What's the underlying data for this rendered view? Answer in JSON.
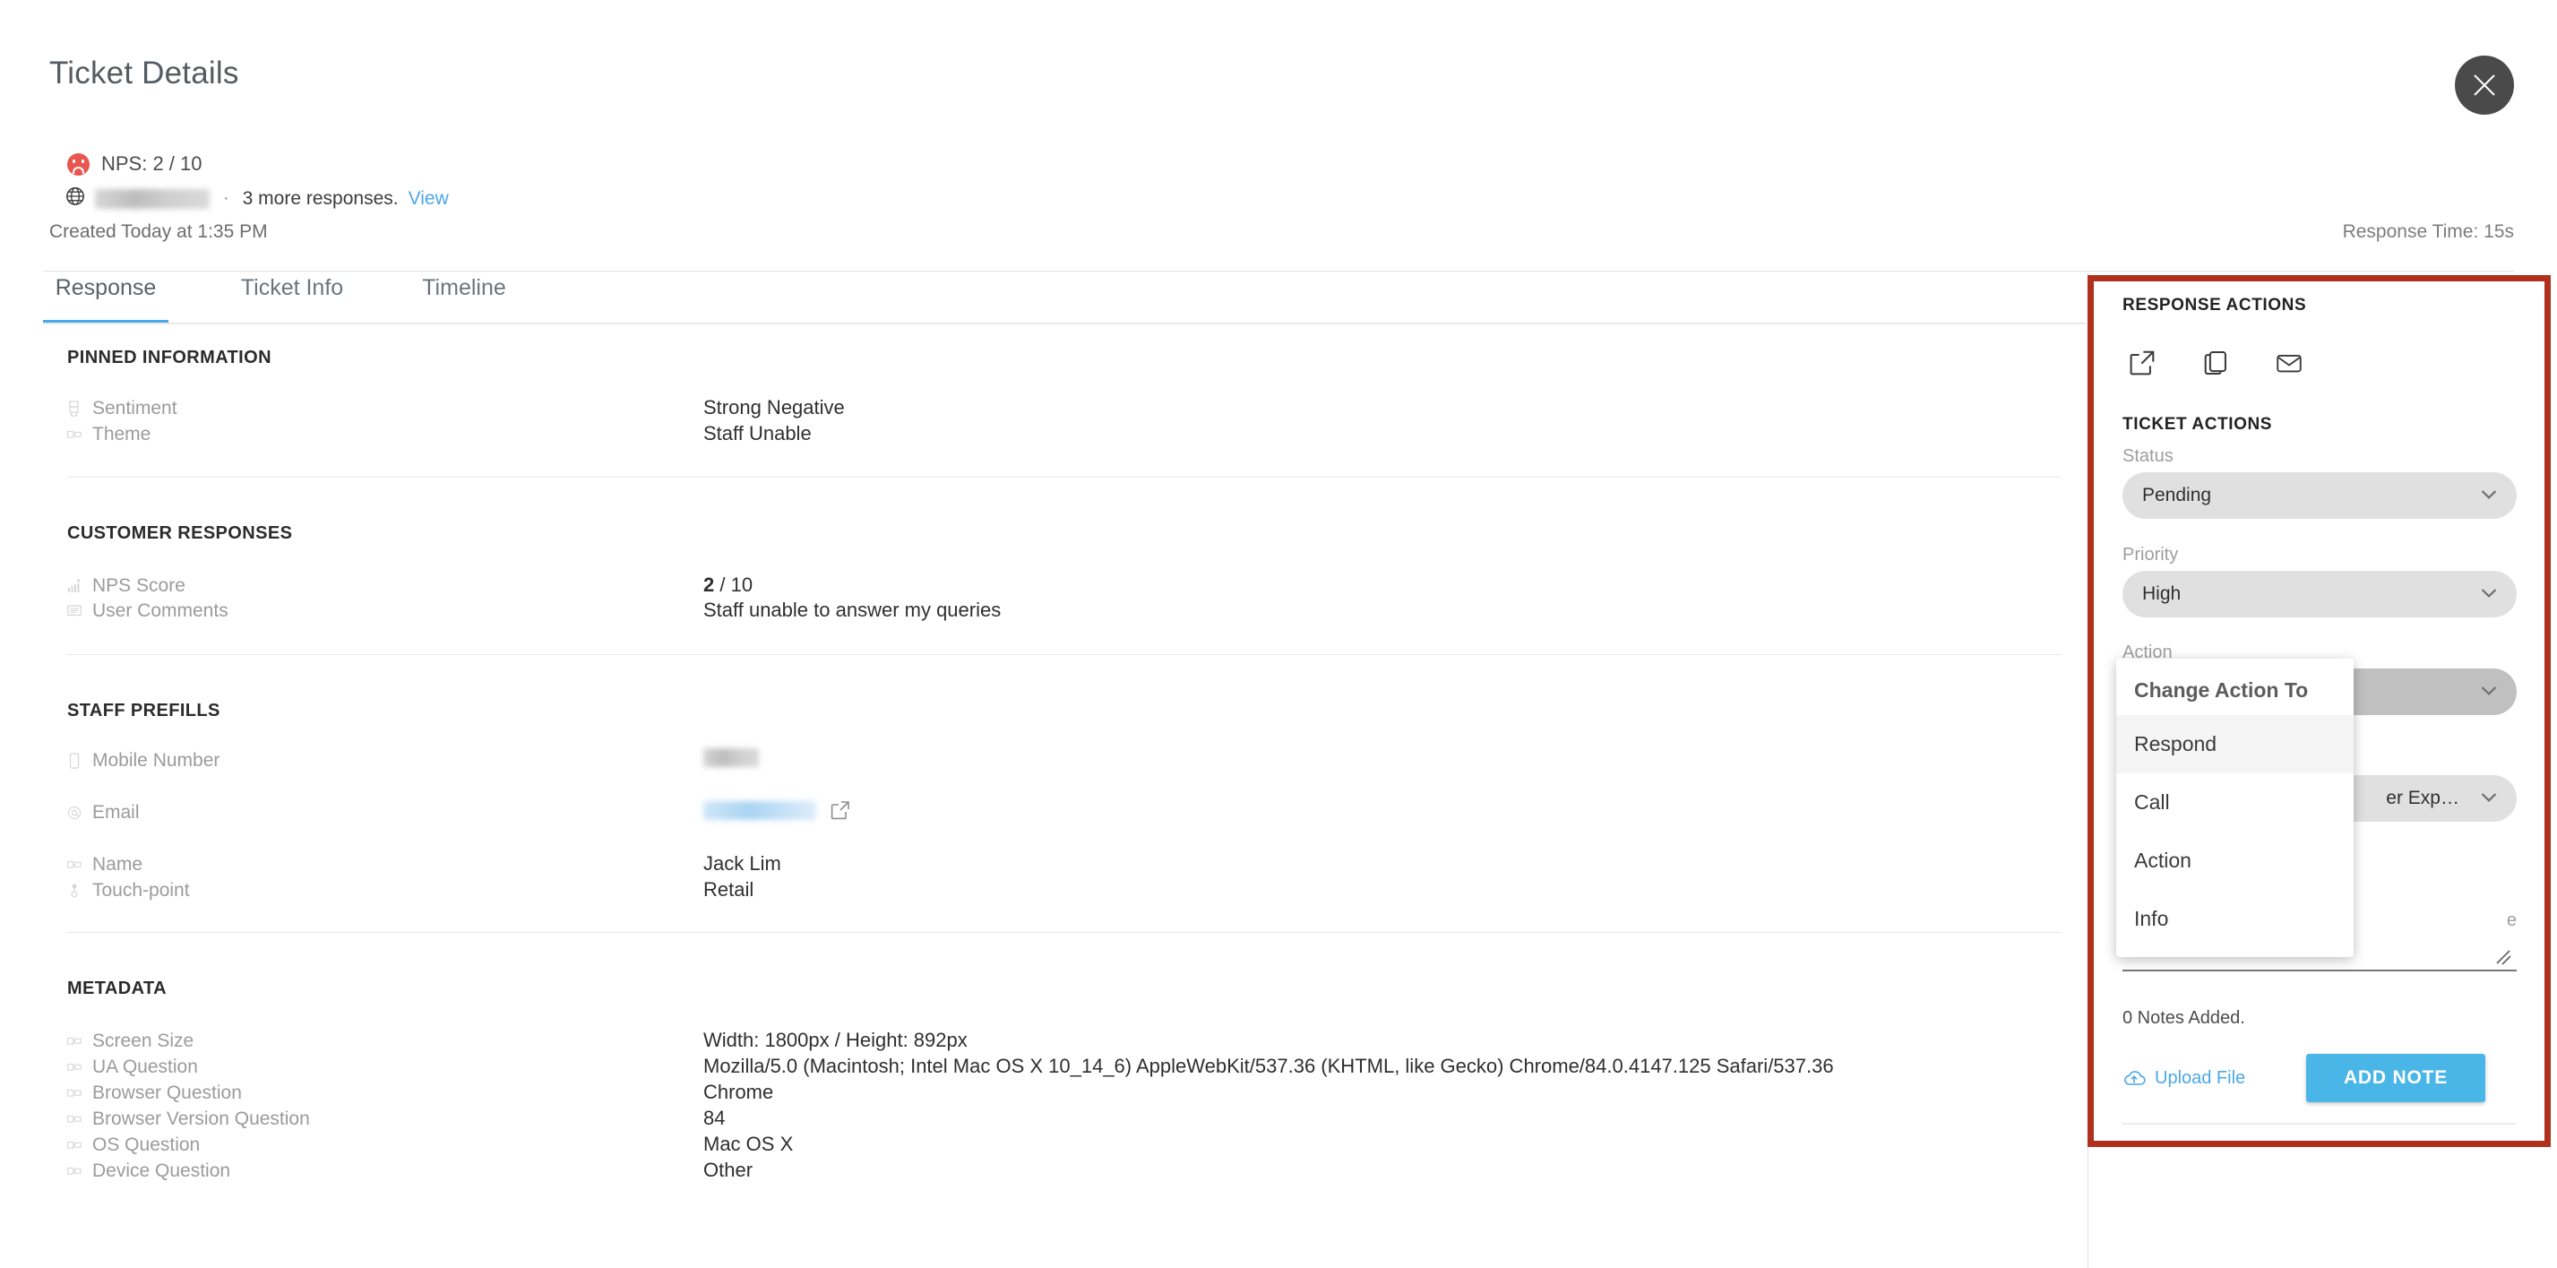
{
  "header": {
    "title": "Ticket Details",
    "close_icon": "close-icon",
    "nps_summary": "NPS: 2 / 10",
    "nps_icon": "sad-face-icon",
    "globe_icon": "globe-icon",
    "url_redacted": "",
    "separator": "·",
    "more_responses": "3 more responses.",
    "view_link": "View",
    "created": "Created Today at 1:35 PM",
    "response_time": "Response Time: 15s"
  },
  "tabs": [
    {
      "label": "Response",
      "active": true
    },
    {
      "label": "Ticket Info",
      "active": false
    },
    {
      "label": "Timeline",
      "active": false
    }
  ],
  "sections": [
    {
      "title": "PINNED INFORMATION",
      "rows": [
        {
          "icon": "checklist-icon",
          "label": "Sentiment",
          "value": "Strong Negative"
        },
        {
          "icon": "text-field-icon",
          "label": "Theme",
          "value": "Staff Unable"
        }
      ]
    },
    {
      "title": "CUSTOMER RESPONSES",
      "rows": [
        {
          "icon": "bar-chart-icon",
          "label": "NPS Score",
          "value_bold": "2",
          "value": " / 10"
        },
        {
          "icon": "comment-icon",
          "label": "User Comments",
          "value": "Staff unable to answer my queries"
        }
      ]
    },
    {
      "title": "STAFF PREFILLS",
      "rows": [
        {
          "icon": "mobile-icon",
          "label": "Mobile Number",
          "value": "",
          "redacted": "mobile"
        },
        {
          "icon": "at-icon",
          "label": "Email",
          "value": "",
          "redacted": "email",
          "external_link_icon": "external-link-icon"
        },
        {
          "icon": "text-field-icon",
          "label": "Name",
          "value": "Jack Lim"
        },
        {
          "icon": "pin-icon",
          "label": "Touch-point",
          "value": "Retail"
        }
      ]
    },
    {
      "title": "METADATA",
      "rows": [
        {
          "icon": "text-field-icon",
          "label": "Screen Size",
          "value": "Width: 1800px / Height: 892px"
        },
        {
          "icon": "text-field-icon",
          "label": "UA Question",
          "value": "Mozilla/5.0 (Macintosh; Intel Mac OS X 10_14_6) AppleWebKit/537.36 (KHTML, like Gecko) Chrome/84.0.4147.125 Safari/537.36"
        },
        {
          "icon": "text-field-icon",
          "label": "Browser Question",
          "value": "Chrome"
        },
        {
          "icon": "text-field-icon",
          "label": "Browser Version Question",
          "value": "84"
        },
        {
          "icon": "text-field-icon",
          "label": "OS Question",
          "value": "Mac OS X"
        },
        {
          "icon": "text-field-icon",
          "label": "Device Question",
          "value": "Other"
        }
      ]
    }
  ],
  "right_panel": {
    "response_actions_title": "RESPONSE ACTIONS",
    "action_icons": [
      {
        "name": "external-link-icon"
      },
      {
        "name": "copy-icon"
      },
      {
        "name": "mail-icon"
      }
    ],
    "ticket_actions_title": "TICKET ACTIONS",
    "fields": [
      {
        "label": "Status",
        "value": "Pending",
        "state": "normal"
      },
      {
        "label": "Priority",
        "value": "High",
        "state": "normal"
      },
      {
        "label": "Action",
        "value": "",
        "state": "dim"
      },
      {
        "label": "",
        "value": "er Exp…",
        "state": "normal"
      }
    ],
    "note_placeholder": "e",
    "notes_count": "0 Notes Added.",
    "upload_label": "Upload File",
    "upload_icon": "cloud-upload-icon",
    "add_note_label": "ADD NOTE"
  },
  "dropdown": {
    "heading": "Change Action To",
    "items": [
      {
        "label": "Respond",
        "highlighted": true
      },
      {
        "label": "Call",
        "highlighted": false
      },
      {
        "label": "Action",
        "highlighted": false
      },
      {
        "label": "Info",
        "highlighted": false
      }
    ]
  },
  "colors": {
    "accent_blue": "#4aa8e8",
    "highlight_box": "#b0301e",
    "nps_red": "#e8564f",
    "button_blue": "#4ab6e8"
  }
}
